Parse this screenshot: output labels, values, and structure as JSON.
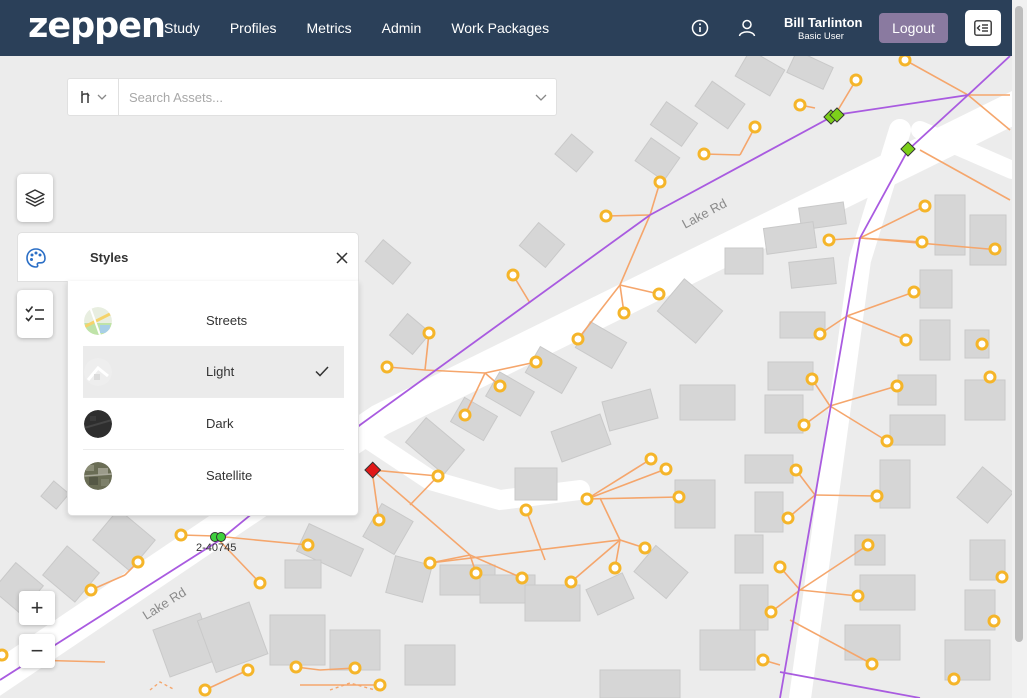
{
  "header": {
    "logo": "zeppen",
    "nav": [
      "Study",
      "Profiles",
      "Metrics",
      "Admin",
      "Work Packages"
    ],
    "user_name": "Bill Tarlinton",
    "user_role": "Basic User",
    "logout_label": "Logout"
  },
  "search": {
    "placeholder": "Search Assets..."
  },
  "styles_panel": {
    "title": "Styles",
    "options": [
      {
        "label": "Streets",
        "selected": false
      },
      {
        "label": "Light",
        "selected": true
      },
      {
        "label": "Dark",
        "selected": false
      },
      {
        "label": "Satellite",
        "selected": false
      }
    ]
  },
  "zoom": {
    "in_label": "+",
    "out_label": "−"
  },
  "map": {
    "road_labels": [
      "Lake Rd",
      "Lake Rd"
    ],
    "asset_label": "2-40745"
  },
  "colors": {
    "header_bg": "#2b4059",
    "logout_bg": "#8a7aa0",
    "primary_line": "#a95be0",
    "secondary_line": "#f5a66c",
    "node": "#f5b52a",
    "switch_green": "#7ccf1a",
    "switch_red": "#e01818"
  }
}
